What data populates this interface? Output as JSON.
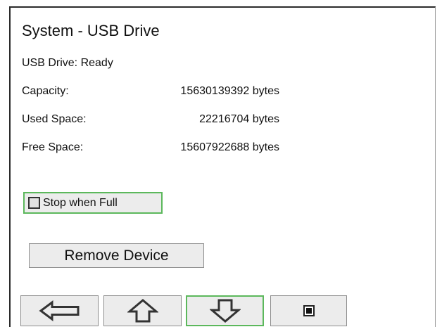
{
  "title": "System - USB Drive",
  "status": "USB Drive: Ready",
  "rows": [
    {
      "label": "Capacity:",
      "value": "15630139392 bytes"
    },
    {
      "label": "Used Space:",
      "value": "22216704 bytes"
    },
    {
      "label": "Free Space:",
      "value": "15607922688 bytes"
    }
  ],
  "stop_when_full": {
    "label": "Stop when Full",
    "checked": false
  },
  "remove_button": {
    "label": "Remove Device"
  },
  "nav": {
    "buttons": [
      {
        "icon": "arrow-left-icon"
      },
      {
        "icon": "arrow-up-icon"
      },
      {
        "icon": "arrow-down-icon",
        "focused": true
      },
      {
        "icon": "stop-icon"
      }
    ]
  },
  "colors": {
    "focus": "#5cb85c",
    "button_bg": "#ececec"
  }
}
